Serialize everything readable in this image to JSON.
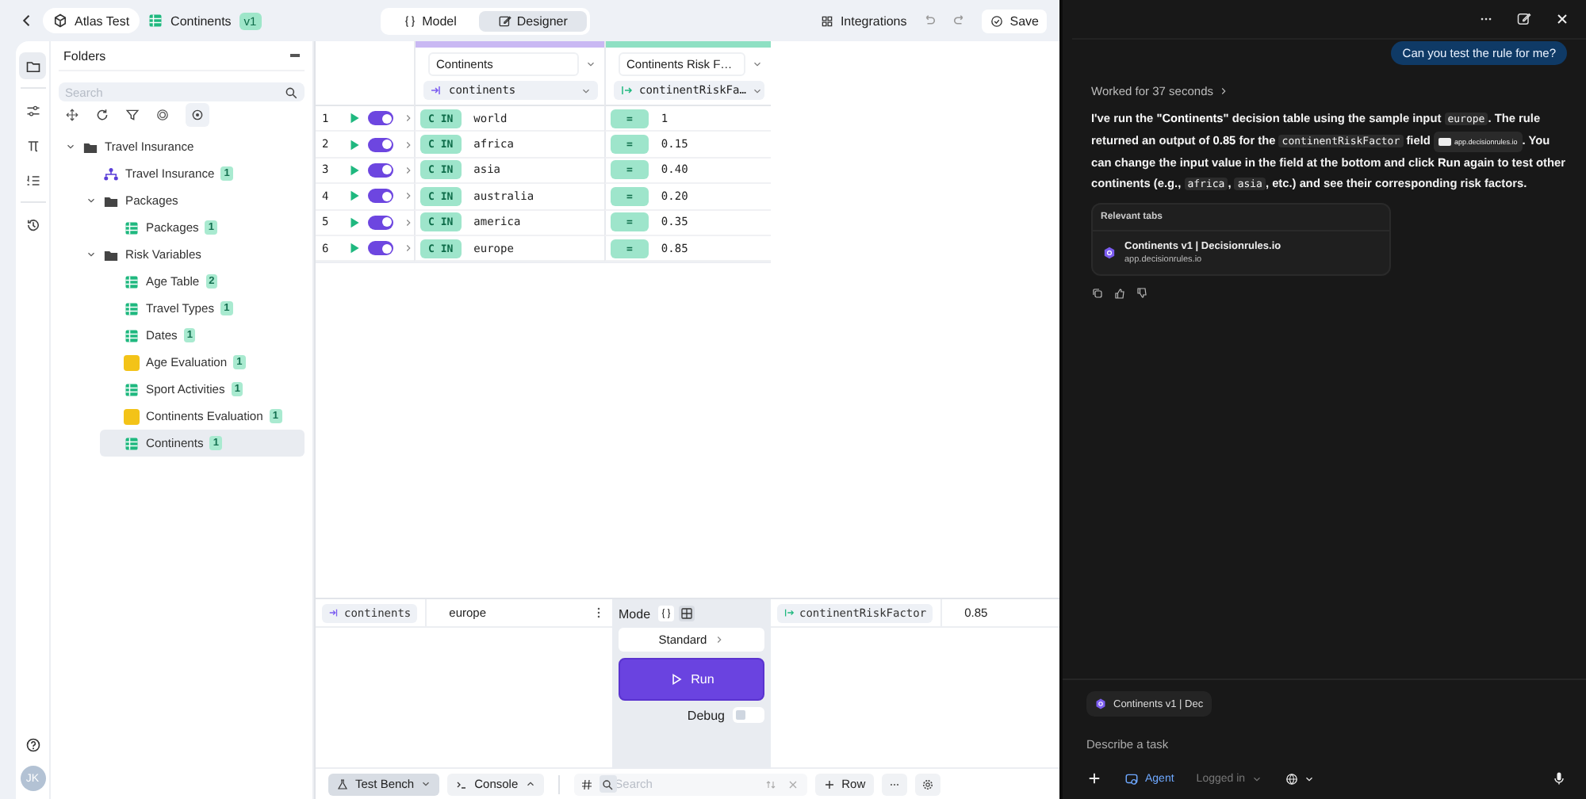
{
  "topbar": {
    "project": "Atlas Test",
    "document": {
      "name": "Continents",
      "version": "v1"
    },
    "view_tabs": [
      {
        "kind": "model",
        "label": "Model",
        "selected": false
      },
      {
        "kind": "designer",
        "label": "Designer",
        "selected": true
      }
    ],
    "integrations": "Integrations",
    "save": "Save"
  },
  "rail": [
    {
      "kind": "folder",
      "selected": true
    },
    {
      "kind": "sliders",
      "selected": false
    },
    {
      "kind": "pi",
      "selected": false
    },
    {
      "kind": "list",
      "selected": false
    },
    {
      "kind": "history",
      "selected": false
    }
  ],
  "avatar": "JK",
  "folders": {
    "title": "Folders",
    "search_placeholder": "Search",
    "tree": [
      {
        "kind": "folder",
        "label": "Travel Insurance",
        "expanded": true,
        "selected": false,
        "children": [
          {
            "kind": "flow",
            "label": "Travel Insurance",
            "count": "1",
            "selected": false
          },
          {
            "kind": "folder",
            "label": "Packages",
            "expanded": true,
            "selected": false,
            "children": [
              {
                "kind": "table",
                "label": "Packages",
                "count": "1",
                "selected": false
              }
            ]
          },
          {
            "kind": "folder",
            "label": "Risk Variables",
            "expanded": true,
            "selected": false,
            "children": [
              {
                "kind": "table",
                "label": "Age Table",
                "count": "2",
                "selected": false
              },
              {
                "kind": "table",
                "label": "Travel Types",
                "count": "1",
                "selected": false
              },
              {
                "kind": "table",
                "label": "Dates",
                "count": "1",
                "selected": false
              },
              {
                "kind": "js",
                "label": "Age Evaluation",
                "count": "1",
                "selected": false
              },
              {
                "kind": "table",
                "label": "Sport Activities",
                "count": "1",
                "selected": false
              },
              {
                "kind": "js",
                "label": "Continents Evaluation",
                "count": "1",
                "selected": false
              },
              {
                "kind": "table",
                "label": "Continents",
                "count": "1",
                "selected": true
              }
            ]
          }
        ]
      }
    ]
  },
  "table": {
    "columns": [
      {
        "kind": "input",
        "title": "Continents",
        "variable": "continents"
      },
      {
        "kind": "output",
        "title": "Continents Risk F…",
        "variable": "continentRiskFa…"
      }
    ],
    "rows": [
      {
        "number": "1",
        "enabled": true,
        "operator": "C IN",
        "value": "world",
        "result_operator": "=",
        "result": "1"
      },
      {
        "number": "2",
        "enabled": true,
        "operator": "C IN",
        "value": "africa",
        "result_operator": "=",
        "result": "0.15"
      },
      {
        "number": "3",
        "enabled": true,
        "operator": "C IN",
        "value": "asia",
        "result_operator": "=",
        "result": "0.40"
      },
      {
        "number": "4",
        "enabled": true,
        "operator": "C IN",
        "value": "australia",
        "result_operator": "=",
        "result": "0.20"
      },
      {
        "number": "5",
        "enabled": true,
        "operator": "C IN",
        "value": "america",
        "result_operator": "=",
        "result": "0.35"
      },
      {
        "number": "6",
        "enabled": true,
        "operator": "C IN",
        "value": "europe",
        "result_operator": "=",
        "result": "0.85"
      }
    ]
  },
  "test_bench": {
    "input": {
      "variable": "continents",
      "value": "europe"
    },
    "mode_label": "Mode",
    "mode_options": [
      {
        "kind": "json",
        "selected": false
      },
      {
        "kind": "table",
        "selected": true
      }
    ],
    "strategy": "Standard",
    "run": "Run",
    "debug": {
      "label": "Debug",
      "on": false
    },
    "output": {
      "variable": "continentRiskFactor",
      "value": "0.85"
    }
  },
  "bottom_bar": {
    "test_bench": "Test Bench",
    "console": "Console",
    "search_placeholder": "Search",
    "add_row": "Row"
  },
  "chat": {
    "user_message": "Can you test the rule for me?",
    "worked": "Worked for 37 seconds",
    "answer": [
      {
        "kind": "text",
        "text": "I've run the **\"Continents\"** decision table using the sample input "
      },
      {
        "kind": "code",
        "text": "europe"
      },
      {
        "kind": "text",
        "text": ". The rule returned an output of **0.85** for the "
      },
      {
        "kind": "code",
        "text": "continentRiskFactor"
      },
      {
        "kind": "text",
        "text": " field "
      },
      {
        "kind": "link",
        "text": "app.decisionrules.io"
      },
      {
        "kind": "text",
        "text": ". You can change the input value in the field at the bottom and click **Run** again to test other continents (e.g., "
      },
      {
        "kind": "code",
        "text": "africa"
      },
      {
        "kind": "text",
        "text": ", "
      },
      {
        "kind": "code",
        "text": "asia"
      },
      {
        "kind": "text",
        "text": ", etc.) and see their corresponding risk factors."
      }
    ],
    "relevant_tabs": {
      "title": "Relevant tabs",
      "items": [
        {
          "title": "Continents v1 | Decisionrules.io",
          "url": "app.decisionrules.io"
        }
      ]
    },
    "context_chip": "Continents v1 | Dec",
    "input_placeholder": "Describe a task",
    "agent": "Agent",
    "account": "Logged in"
  }
}
